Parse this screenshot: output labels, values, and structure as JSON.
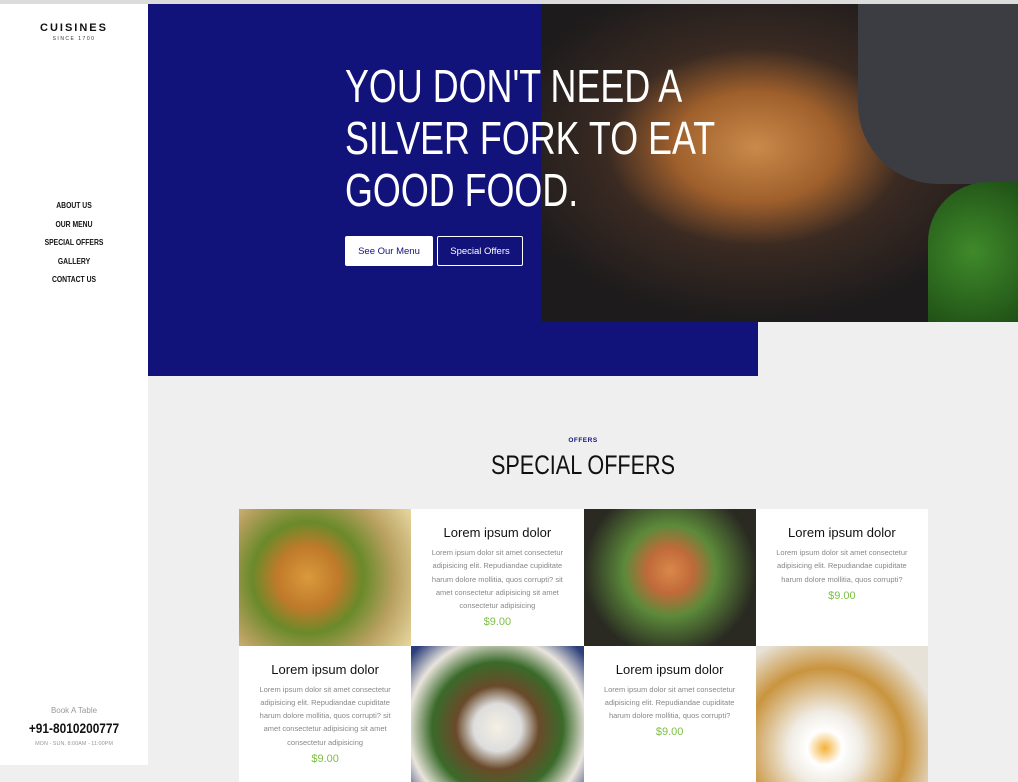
{
  "brand": {
    "name": "CUISINES",
    "since": "SINCE 1700"
  },
  "nav": [
    "ABOUT US",
    "OUR MENU",
    "SPECIAL OFFERS",
    "GALLERY",
    "CONTACT US"
  ],
  "booking": {
    "label": "Book A Table",
    "phone": "+91-8010200777",
    "hours": "MON - SUN, 8:00AM - 11:00PM"
  },
  "hero": {
    "line1": "YOU DON'T NEED A",
    "line2": "SILVER FORK TO EAT",
    "line3": "GOOD FOOD.",
    "btn_menu": "See Our Menu",
    "btn_offers": "Special Offers"
  },
  "offers": {
    "label": "OFFERS",
    "title": "SPECIAL OFFERS",
    "cards": [
      {
        "title": "Lorem ipsum dolor",
        "text": "Lorem ipsum dolor sit amet consectetur adipisicing elit. Repudiandae cupiditate harum dolore mollitia, quos corrupti? sit amet consectetur adipisicing sit amet consectetur adipisicing",
        "price": "$9.00"
      },
      {
        "title": "Lorem ipsum dolor",
        "text": "Lorem ipsum dolor sit amet consectetur adipisicing elit. Repudiandae cupiditate harum dolore mollitia, quos corrupti?",
        "price": "$9.00"
      },
      {
        "title": "Lorem ipsum dolor",
        "text": "Lorem ipsum dolor sit amet consectetur adipisicing elit. Repudiandae cupiditate harum dolore mollitia, quos corrupti? sit amet consectetur adipisicing sit amet consectetur adipisicing",
        "price": "$9.00"
      },
      {
        "title": "Lorem ipsum dolor",
        "text": "Lorem ipsum dolor sit amet consectetur adipisicing elit. Repudiandae cupiditate harum dolore mollitia, quos corrupti?",
        "price": "$9.00"
      }
    ]
  },
  "colors": {
    "brand_blue": "#12137a",
    "price_green": "#7cc142"
  }
}
